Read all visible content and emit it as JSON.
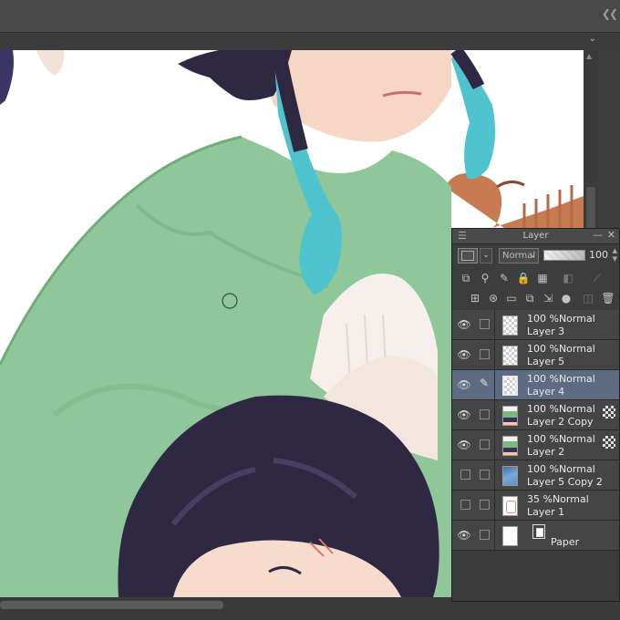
{
  "panel": {
    "title": "Layer",
    "blend_mode": "Normal",
    "opacity": "100"
  },
  "layers": [
    {
      "opacity": "100 %",
      "mode": "Normal",
      "name": "Layer 3",
      "visible": true,
      "thumb": "checker"
    },
    {
      "opacity": "100 %",
      "mode": "Normal",
      "name": "Layer 5",
      "visible": true,
      "thumb": "checker"
    },
    {
      "opacity": "100 %",
      "mode": "Normal",
      "name": "Layer 4",
      "visible": true,
      "thumb": "checker",
      "active": true
    },
    {
      "opacity": "100 %",
      "mode": "Normal",
      "name": "Layer 2 Copy",
      "visible": true,
      "thumb": "art",
      "mask": true
    },
    {
      "opacity": "100 %",
      "mode": "Normal",
      "name": "Layer 2",
      "visible": true,
      "thumb": "art",
      "mask": true
    },
    {
      "opacity": "100 %",
      "mode": "Normal",
      "name": "Layer 5 Copy 2",
      "visible": false,
      "thumb": "blue"
    },
    {
      "opacity": "35 %",
      "mode": "Normal",
      "name": "Layer 1",
      "visible": false,
      "thumb": "sketch"
    },
    {
      "name": "Paper",
      "visible": true,
      "thumb": "paper"
    }
  ],
  "colors": {
    "cloak": "#8fc79a",
    "hair_dark": "#2e2843",
    "braid": "#4fc4cf",
    "skin": "#f7dccd",
    "active_layer": "#5d6c82"
  }
}
